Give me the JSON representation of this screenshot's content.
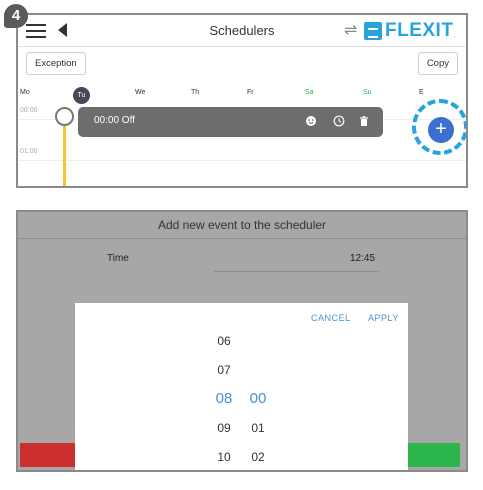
{
  "step_number": "4",
  "scheduler_screen": {
    "title": "Schedulers",
    "logo_text": "FLEXIT",
    "logo_tm": ".",
    "exception_label": "Exception",
    "copy_label": "Copy",
    "days": [
      "Mo",
      "Tu",
      "We",
      "Th",
      "Fr",
      "Sa",
      "Su",
      "E"
    ],
    "times": [
      "00:00",
      "01:00"
    ],
    "event_text": "00:00 Off",
    "add_button": "+"
  },
  "add_event_dialog": {
    "title": "Add new event to the scheduler",
    "time_label": "Time",
    "time_value": "12:45",
    "picker": {
      "cancel_label": "CANCEL",
      "apply_label": "APPLY",
      "hours": [
        "06",
        "07",
        "08",
        "09",
        "10"
      ],
      "minutes": [
        "00",
        "01",
        "02"
      ],
      "selected_hour": "08",
      "selected_minute": "00"
    }
  },
  "colors": {
    "accent_blue": "#29a3dc",
    "fab_blue": "#3d6fd0",
    "weekend_green": "#2bb54b",
    "timeline_yellow": "#f7c531",
    "cancel_red": "#cc2d2d"
  }
}
